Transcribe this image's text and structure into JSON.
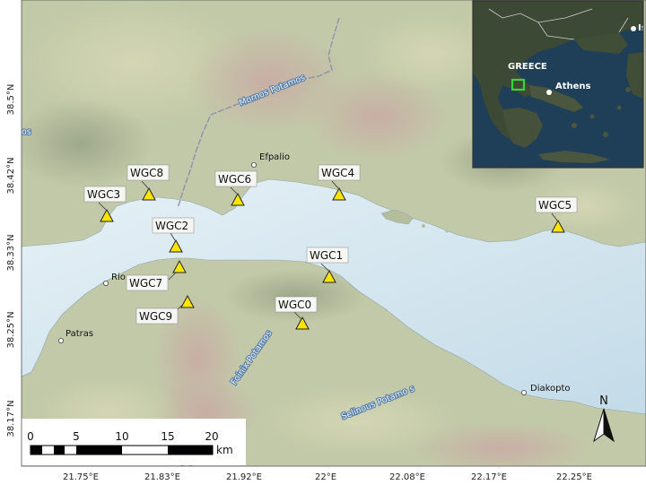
{
  "lat_labels": [
    "38.5°N",
    "38.42°N",
    "38.33°N",
    "38.25°N",
    "38.17°N"
  ],
  "lon_labels": [
    "21.75°E",
    "21.83°E",
    "21.92°E",
    "22°E",
    "22.08°E",
    "22.17°E",
    "22.25°E"
  ],
  "stations": [
    {
      "name": "WGC0"
    },
    {
      "name": "WGC1"
    },
    {
      "name": "WGC2"
    },
    {
      "name": "WGC3"
    },
    {
      "name": "WGC4"
    },
    {
      "name": "WGC5"
    },
    {
      "name": "WGC6"
    },
    {
      "name": "WGC7"
    },
    {
      "name": "WGC8"
    },
    {
      "name": "WGC9"
    }
  ],
  "places": {
    "efpalio": "Efpalio",
    "rio": "Rio",
    "patras": "Patras",
    "diakopto": "Diakopto"
  },
  "rivers": {
    "mornos": "Mornos Potamos",
    "foinix": "Foinix Potamos",
    "selinous": "Selinous Potamo s"
  },
  "partial_labels": {
    "left_edge": "os",
    "bottom_edge": "Achaea"
  },
  "inset": {
    "country": "GREECE",
    "city": "Athens",
    "corner": "Is"
  },
  "scale": {
    "ticks": [
      "0",
      "5",
      "10",
      "15",
      "20"
    ],
    "unit": "km"
  },
  "north": "N",
  "colors": {
    "sea": "#cfe3ee",
    "land": "#b9c3a3",
    "station": "#ffe400",
    "inset_box": "#3cd23c"
  }
}
